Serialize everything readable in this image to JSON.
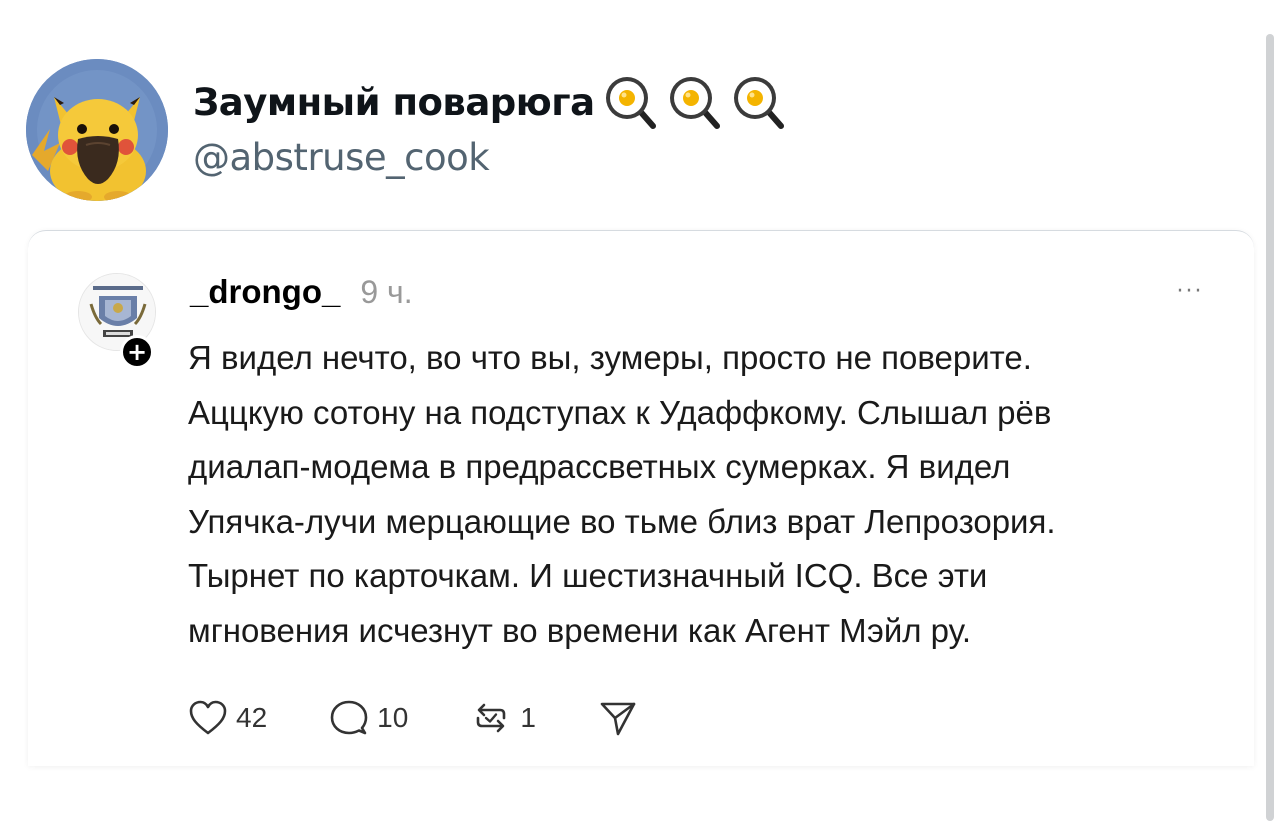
{
  "header": {
    "display_name": "Заумный поварюга",
    "name_emojis": [
      "frying-pan-egg-icon",
      "frying-pan-egg-icon",
      "frying-pan-egg-icon"
    ],
    "handle": "@abstruse_cook"
  },
  "post": {
    "username": "_drongo_",
    "time": "9 ч.",
    "more_label": "···",
    "follow_icon": "plus-icon",
    "text_lines": [
      "Я видел нечто, во что вы, зумеры, просто не поверите.",
      "Аццкую сотону на подступах к Удаффкому. Слышал рёв",
      "диалап-модема в предрассветных сумерках. Я видел",
      "Упячка-лучи мерцающие во тьме близ врат Лепрозория.",
      "Тырнет по карточкам. И шестизначный ICQ. Все эти",
      "мгновения исчезнут во времени как Агент Мэйл ру."
    ],
    "actions": {
      "likes": "42",
      "replies": "10",
      "reposts": "1"
    }
  },
  "colors": {
    "name": "#0f1419",
    "handle": "#536471",
    "time": "#999999",
    "text": "#1a1a1a"
  }
}
